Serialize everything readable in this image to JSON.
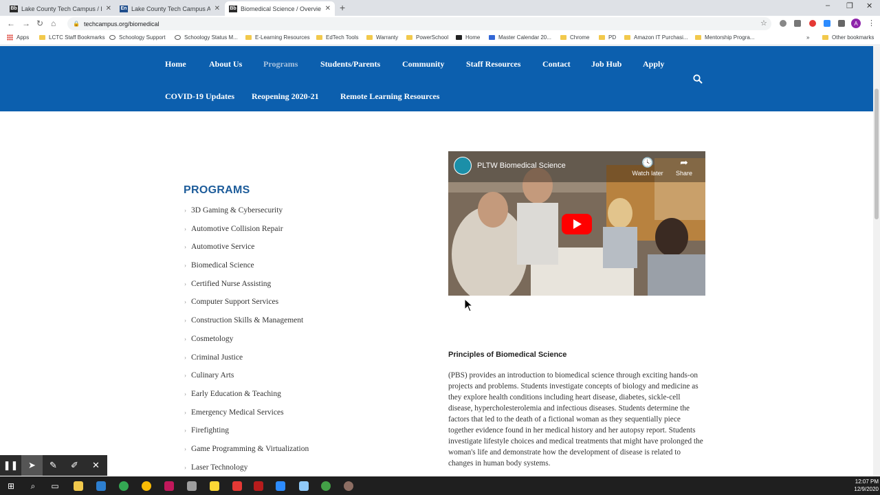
{
  "browser": {
    "tabs": [
      {
        "favicon": "Bb",
        "title": "Lake County Tech Campus / Hom"
      },
      {
        "favicon": "En",
        "title": "Lake County Tech Campus Applic"
      },
      {
        "favicon": "Bb",
        "title": "Biomedical Science / Overview"
      }
    ],
    "url": "techcampus.org/biomedical",
    "profile_initial": "A",
    "bookmarks": [
      "Apps",
      "LCTC Staff Bookmarks",
      "Schoology Support",
      "Schoology Status M...",
      "E-Learning Resources",
      "EdTech Tools",
      "Warranty",
      "PowerSchool",
      "Home",
      "Master Calendar 20...",
      "Chrome",
      "PD",
      "Amazon IT Purchasi...",
      "Mentorship Progra...",
      "Other bookmarks"
    ]
  },
  "site_nav": {
    "row1": [
      "Home",
      "About Us",
      "Programs",
      "Students/Parents",
      "Community",
      "Staff Resources",
      "Contact",
      "Job Hub",
      "Apply"
    ],
    "row2": [
      "COVID-19 Updates",
      "Reopening 2020-21",
      "Remote Learning Resources"
    ],
    "active": "Programs",
    "brand_color": "#0c5fae"
  },
  "sidebar": {
    "heading": "PROGRAMS",
    "items": [
      "3D Gaming & Cybersecurity",
      "Automotive Collision Repair",
      "Automotive Service",
      "Biomedical Science",
      "Certified Nurse Assisting",
      "Computer Support Services",
      "Construction Skills & Management",
      "Cosmetology",
      "Criminal Justice",
      "Culinary Arts",
      "Early Education & Teaching",
      "Emergency Medical Services",
      "Firefighting",
      "Game Programming & Virtualization",
      "Laser Technology"
    ]
  },
  "video": {
    "title": "PLTW Biomedical Science",
    "watch_later": "Watch later",
    "share": "Share"
  },
  "article": {
    "heading": "Principles of Biomedical Science",
    "body": "(PBS) provides an introduction to biomedical science through exciting hands-on projects and problems. Students investigate concepts of biology and medicine as they explore health conditions including heart disease, diabetes, sickle-cell disease, hypercholesterolemia and infectious diseases. Students determine the factors that led to the death of a fictional woman as they sequentially piece together evidence found in her medical history and her autopsy report. Students investigate lifestyle choices and medical treatments that might have prolonged the woman's life and demonstrate how the development of disease is related to changes in human body systems."
  },
  "taskbar": {
    "time": "12:07 PM",
    "date": "12/9/2020"
  }
}
